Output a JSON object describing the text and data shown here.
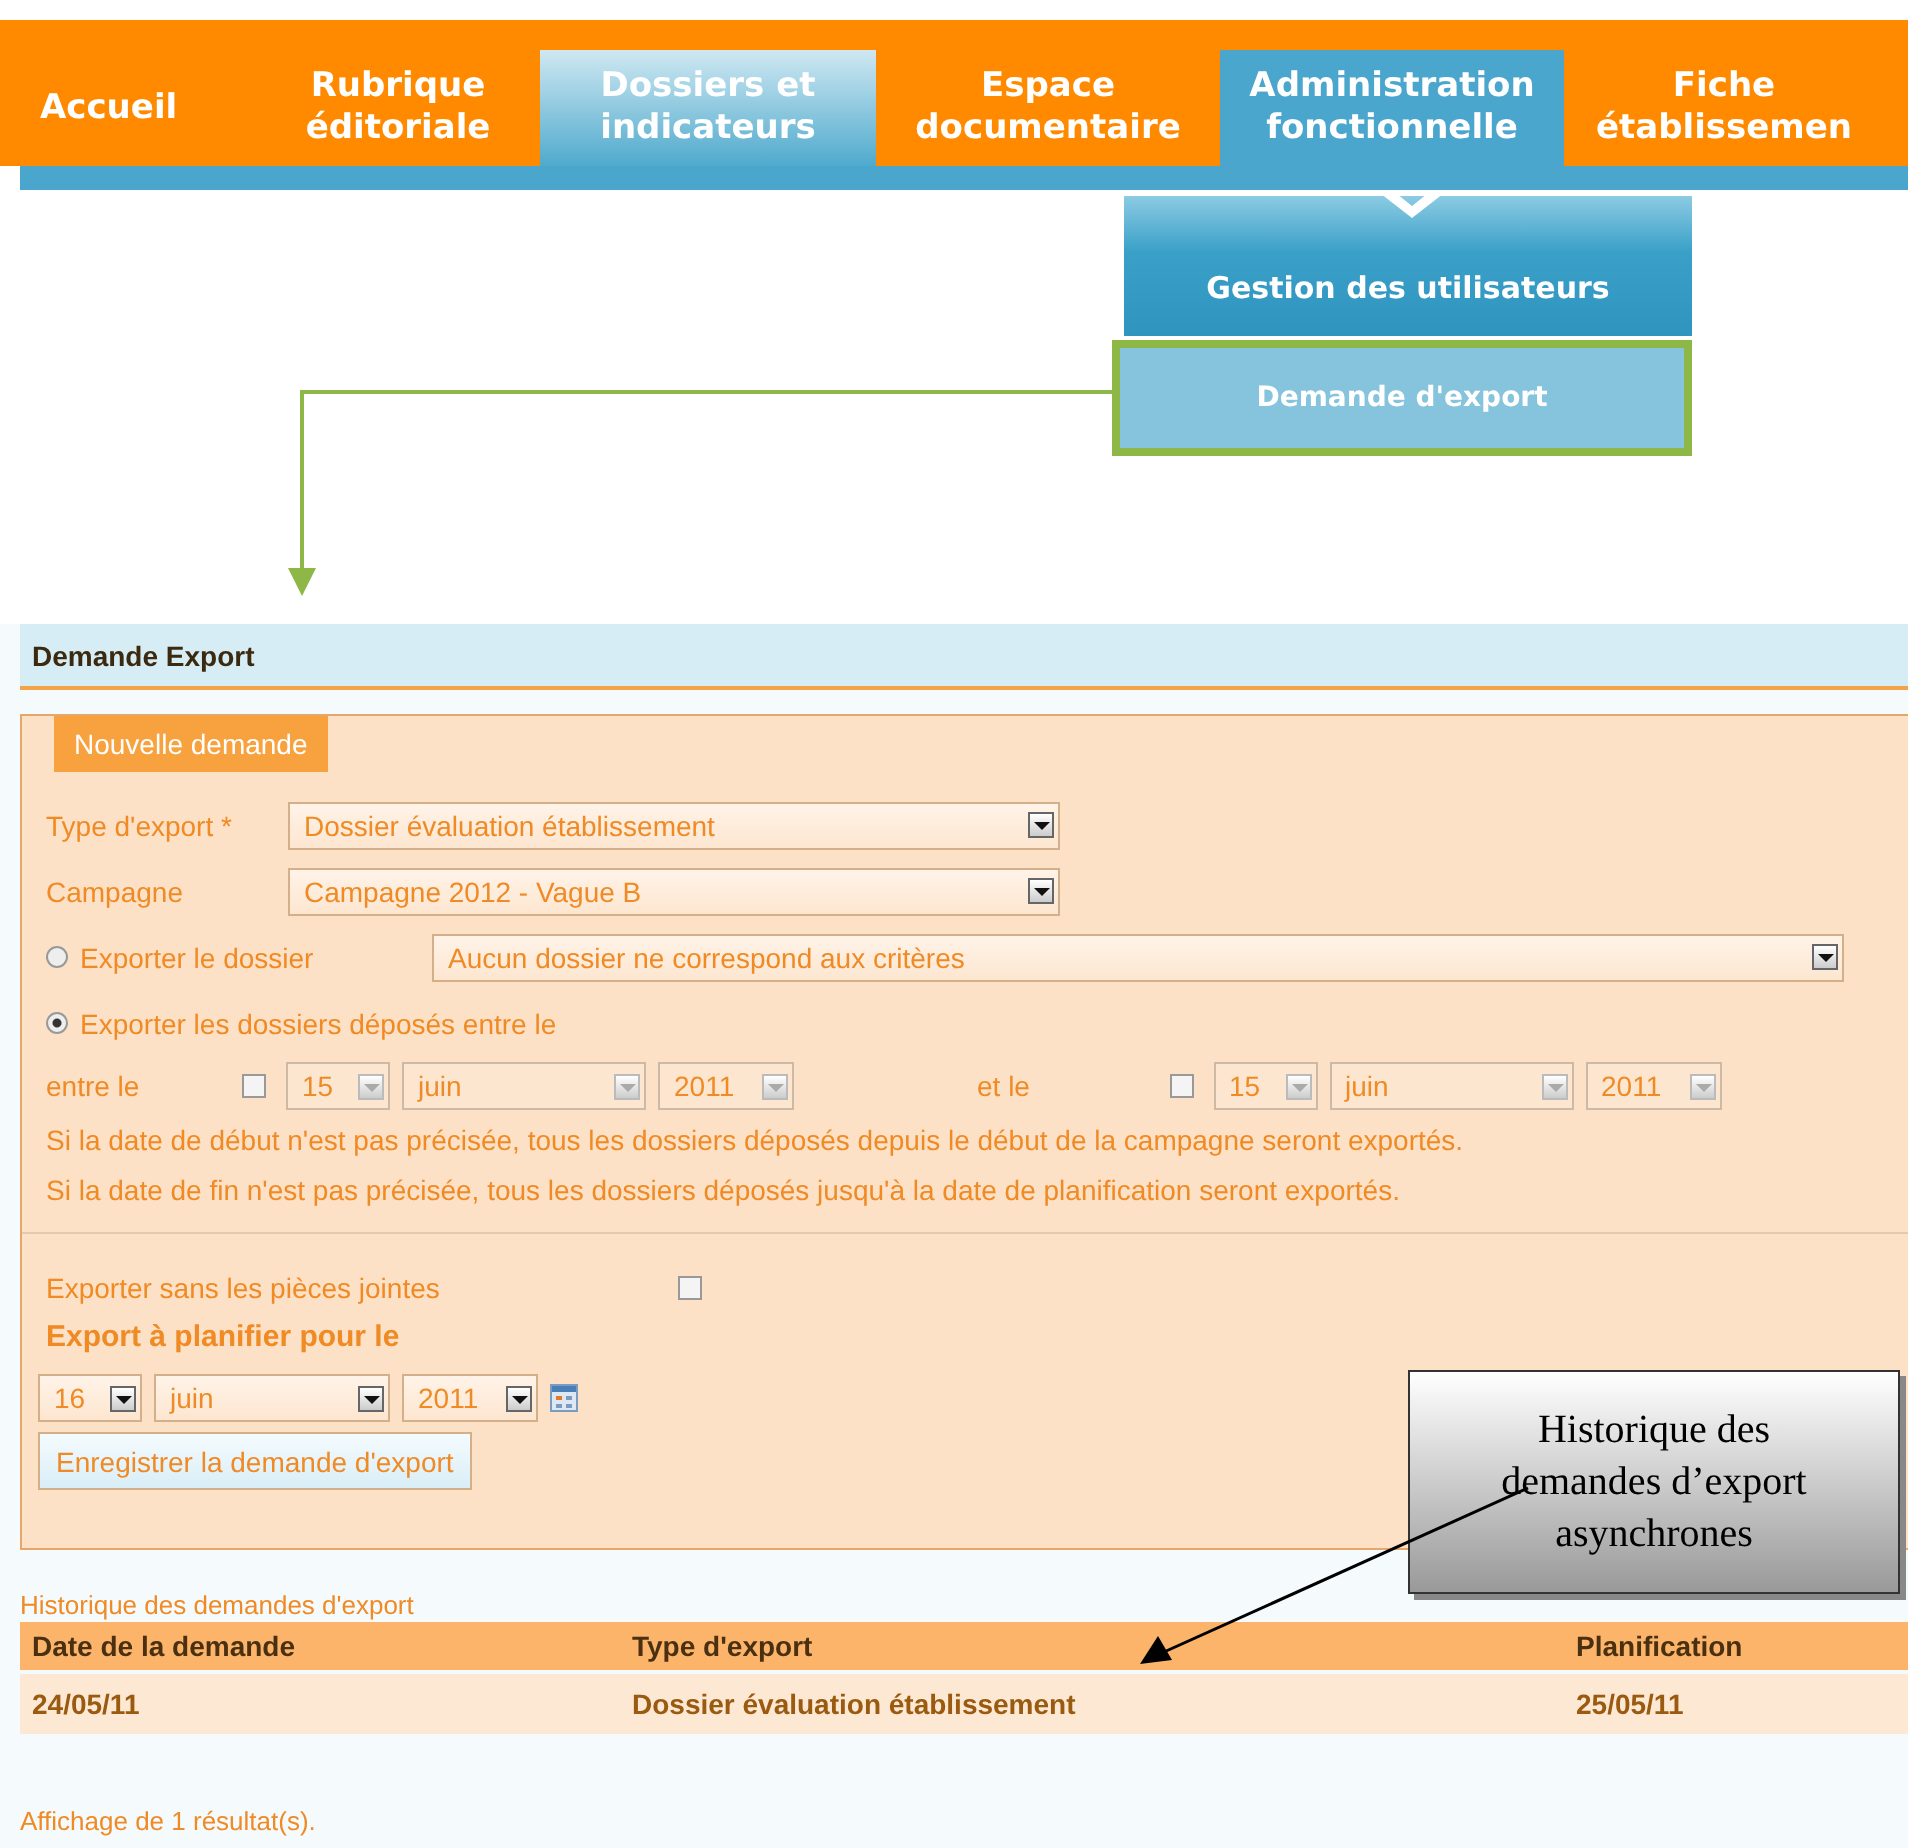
{
  "nav": {
    "tabs": [
      {
        "lines": [
          "Accueil"
        ],
        "selected": false,
        "highlighted": false
      },
      {
        "lines": [
          "Rubrique",
          "éditoriale"
        ],
        "selected": false,
        "highlighted": false
      },
      {
        "lines": [
          "Dossiers et",
          "indicateurs"
        ],
        "selected": false,
        "highlighted": true
      },
      {
        "lines": [
          "Espace",
          "documentaire"
        ],
        "selected": false,
        "highlighted": false
      },
      {
        "lines": [
          "Administration",
          "fonctionnelle"
        ],
        "selected": true,
        "highlighted": false
      },
      {
        "lines": [
          "Fiche",
          "établissemen"
        ],
        "selected": false,
        "highlighted": false
      }
    ]
  },
  "submenu": {
    "items": [
      {
        "label": "Gestion des utilisateurs",
        "selected": false
      },
      {
        "label": "Demande d'export",
        "selected": true
      }
    ]
  },
  "panel": {
    "title": "Demande Export",
    "legend": "Nouvelle demande",
    "type_export": {
      "label": "Type d'export *",
      "value": "Dossier évaluation établissement"
    },
    "campagne": {
      "label": "Campagne",
      "value": "Campagne 2012 - Vague B"
    },
    "options": [
      {
        "label": "Exporter le dossier",
        "selected": false,
        "value": "Aucun dossier ne correspond aux critères"
      },
      {
        "label": "Exporter les dossiers déposés entre le",
        "selected": true
      }
    ],
    "range": [
      {
        "label": "entre le",
        "checked": false,
        "disabled": true,
        "day": "15",
        "month": "juin",
        "year": "2011"
      },
      {
        "label": "et le",
        "checked": false,
        "disabled": true,
        "day": "15",
        "month": "juin",
        "year": "2011"
      }
    ],
    "notes": [
      "Si la date de début n'est pas précisée, tous les dossiers déposés depuis le début de la campagne seront exportés.",
      "Si la date de fin n'est pas précisée, tous les dossiers déposés jusqu'à la date de planification seront exportés."
    ],
    "no_attachments": {
      "label": "Exporter sans les pièces jointes",
      "checked": false
    },
    "schedule": {
      "label": "Export à planifier pour le",
      "day": "16",
      "month": "juin",
      "year": "2011",
      "disabled": false
    },
    "submit": "Enregistrer la demande d'export"
  },
  "history": {
    "title": "Historique des demandes d'export",
    "columns": [
      "Date de la demande",
      "Type d'export",
      "Planification"
    ],
    "rows": [
      [
        "24/05/11",
        "Dossier évaluation établissement",
        "25/05/11"
      ]
    ],
    "footer": "Affichage de 1 résultat(s)."
  },
  "callout": {
    "lines": [
      "Historique des",
      "demandes d’export",
      "asynchrones"
    ]
  }
}
